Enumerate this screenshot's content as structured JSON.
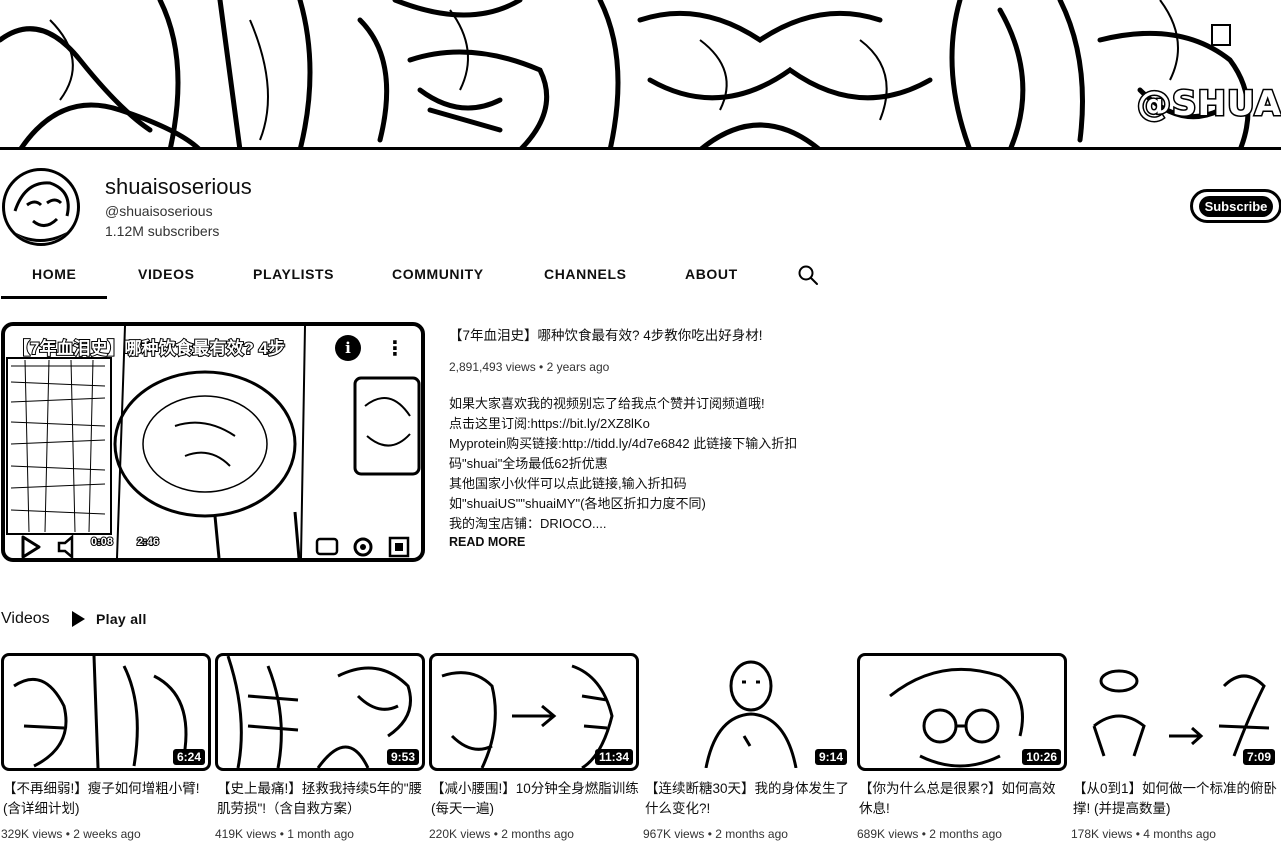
{
  "banner": {
    "handle_text": "@SHUAIS"
  },
  "channel": {
    "name": "shuaisoserious",
    "handle": "@shuaisoserious",
    "subscribers": "1.12M subscribers",
    "subscribe_label": "Subscribe"
  },
  "tabs": [
    {
      "label": "HOME"
    },
    {
      "label": "VIDEOS"
    },
    {
      "label": "PLAYLISTS"
    },
    {
      "label": "COMMUNITY"
    },
    {
      "label": "CHANNELS"
    },
    {
      "label": "ABOUT"
    }
  ],
  "featured": {
    "thumb_title": "【7年血泪史】哪种饮食最有效? 4步",
    "current_time": "0:08",
    "duration": "2:46",
    "title": "【7年血泪史】哪种饮食最有效? 4步教你吃出好身材!",
    "meta": "2,891,493 views • 2 years ago",
    "description": [
      "如果大家喜欢我的视频别忘了给我点个赞并订阅频道哦!",
      "点击这里订阅:https://bit.ly/2XZ8lKo",
      "Myprotein购买链接:http://tidd.ly/4d7e6842   此链接下输入折扣",
      "码\"shuai\"全场最低62折优惠",
      "其他国家小伙伴可以点此链接,输入折扣码",
      "如\"shuaiUS\"\"shuaiMY\"(各地区折扣力度不同)",
      "我的淘宝店铺：DRIOCO...."
    ],
    "read_more": "READ MORE"
  },
  "shelf": {
    "title": "Videos",
    "play_all": "Play all",
    "videos": [
      {
        "title": "【不再细弱!】瘦子如何增粗小臂!(含详细计划)",
        "duration": "6:24",
        "meta": "329K views • 2 weeks ago"
      },
      {
        "title": "【史上最痛!】拯救我持续5年的\"腰肌劳损\"!（含自救方案）",
        "duration": "9:53",
        "meta": "419K views • 1 month ago"
      },
      {
        "title": "【减小腰围!】10分钟全身燃脂训练(每天一遍)",
        "duration": "11:34",
        "meta": "220K views • 2 months ago"
      },
      {
        "title": "【连续断糖30天】我的身体发生了什么变化?!",
        "duration": "9:14",
        "meta": "967K views • 2 months ago"
      },
      {
        "title": "【你为什么总是很累?】如何高效休息!",
        "duration": "10:26",
        "meta": "689K views • 2 months ago"
      },
      {
        "title": "【从0到1】如何做一个标准的俯卧撑! (并提高数量)",
        "duration": "7:09",
        "meta": "178K views • 4 months ago"
      }
    ]
  }
}
